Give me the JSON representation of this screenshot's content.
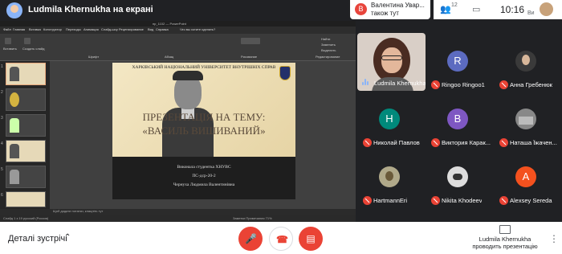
{
  "topbar": {
    "presenting_title": "Ludmila Khernukha на екрані",
    "notice_initial": "В",
    "notice_text": "Валентина Увар... також тут",
    "participant_count": "12",
    "clock": "10:16",
    "you_label": "Ви"
  },
  "powerpoint": {
    "window_title": "пр_1102 — PowerPoint",
    "tabs": [
      "Файл",
      "Главная",
      "Вставка",
      "Конструктор",
      "Переходы",
      "Анимация",
      "Слайд-шоу",
      "Рецензирование",
      "Вид",
      "Справка",
      "Что вы хотите сделать?"
    ],
    "ribbon_labels": [
      "Вставить",
      "Создать слайд",
      "Шрифт",
      "Абзац",
      "Рисование",
      "Редактирование",
      "Найти",
      "Заменить",
      "Выделить"
    ],
    "thumb_numbers": [
      "1",
      "2",
      "3",
      "4",
      "5",
      "6"
    ],
    "slide": {
      "university": "ХАРКІВСЬКИЙ НАЦІОНАЛЬНИЙ УНІВЕРСИТЕТ ВНУТРІШНІХ СПРАВ",
      "heading1": "ПРЕЗЕНТАЦІЯ НА ТЕМУ:",
      "heading2": "«ВАСИЛЬ ВИШИВАНИЙ»",
      "author_line1": "Виконала студентка ХНУВС",
      "author_line2": "ПС-дср-20-2",
      "author_line3": "Чернуха Людмила Валентинівна"
    },
    "notes_placeholder": "Щоб додати нотатки, клацніть тут",
    "status_left": "Слайд 1 з 19   русский (Россия)",
    "status_right": "Заметки   Примечания   71%"
  },
  "participants": [
    {
      "name": "Ludmila Khernukha",
      "type": "video",
      "speaking": true
    },
    {
      "name": "Ringoo Ringoo1",
      "initial": "R",
      "color": "#5c6bc0"
    },
    {
      "name": "Анна Гребенюк",
      "type": "photo",
      "color": "#3a3a3a"
    },
    {
      "name": "Николай Павлов",
      "initial": "Н",
      "color": "#00897b"
    },
    {
      "name": "Виктория Карак...",
      "initial": "В",
      "color": "#7e57c2"
    },
    {
      "name": "Наташа Їжачен...",
      "type": "photo",
      "color": "#888888"
    },
    {
      "name": "HartmannEri",
      "type": "photo",
      "color": "#b0a98a"
    },
    {
      "name": "Nikita Khodeev",
      "type": "photo",
      "color": "#dddddd"
    },
    {
      "name": "Alexsey Sereda",
      "initial": "A",
      "color": "#f4511e"
    }
  ],
  "bottombar": {
    "details_label": "Деталі зустрічі",
    "presenting_line1": "Ludmila Khernukha",
    "presenting_line2": "проводить презентацію",
    "colors": {
      "danger": "#ea4335"
    }
  }
}
